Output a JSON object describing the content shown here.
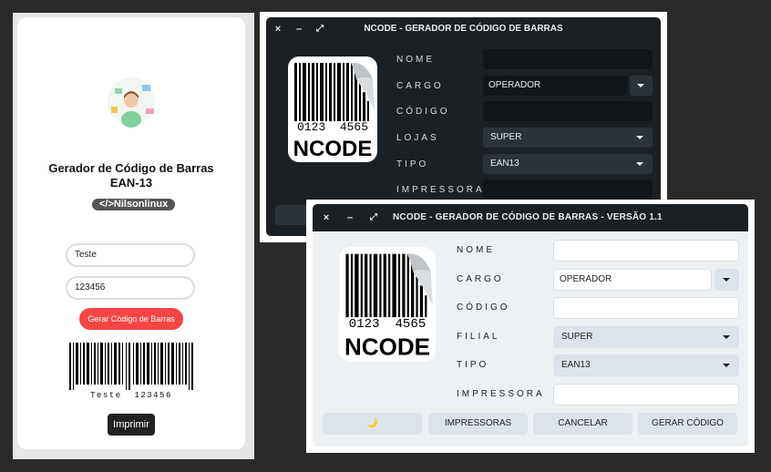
{
  "web_app": {
    "title_line1": "Gerador de Código de Barras",
    "title_line2": "EAN-13",
    "badge": "</>Nilsonlinux",
    "input_name_value": "Teste",
    "input_code_value": "123456",
    "generate_button": "Gerar Código de Barras",
    "barcode_caption": "Teste  123456",
    "print_button": "Imprimir"
  },
  "dark_window": {
    "controls": {
      "close": "×",
      "minimize": "–",
      "maximize": "⤢"
    },
    "title": "NCODE - GERADOR DE CÓDIGO DE BARRAS",
    "logo_number": "0123  4565",
    "logo_text": "NCODE",
    "labels": {
      "nome": "NOME",
      "cargo": "CARGO",
      "codigo": "CÓDIGO",
      "lojas": "LOJAS",
      "tipo": "TIPO",
      "impressora": "IMPRESSORA"
    },
    "values": {
      "cargo": "OPERADOR",
      "lojas": "SUPER",
      "tipo": "EAN13"
    }
  },
  "light_window": {
    "controls": {
      "close": "×",
      "minimize": "–",
      "maximize": "⤢"
    },
    "title": "NCODE - GERADOR DE CÓDIGO DE BARRAS - VERSÃO 1.1",
    "logo_number": "0123  4565",
    "logo_text": "NCODE",
    "labels": {
      "nome": "NOME",
      "cargo": "CARGO",
      "codigo": "CÓDIGO",
      "filial": "FILIAL",
      "tipo": "TIPO",
      "impressora": "IMPRESSORA"
    },
    "values": {
      "cargo": "OPERADOR",
      "filial": "SUPER",
      "tipo": "EAN13"
    },
    "buttons": {
      "theme": "🌙",
      "impressoras": "IMPRESSORAS",
      "cancelar": "CANCELAR",
      "gerar": "GERAR CÓDIGO"
    }
  },
  "colors": {
    "dark_bg": "#1b2025",
    "accent_red": "#f44545",
    "light_bg": "#eef1f4"
  }
}
